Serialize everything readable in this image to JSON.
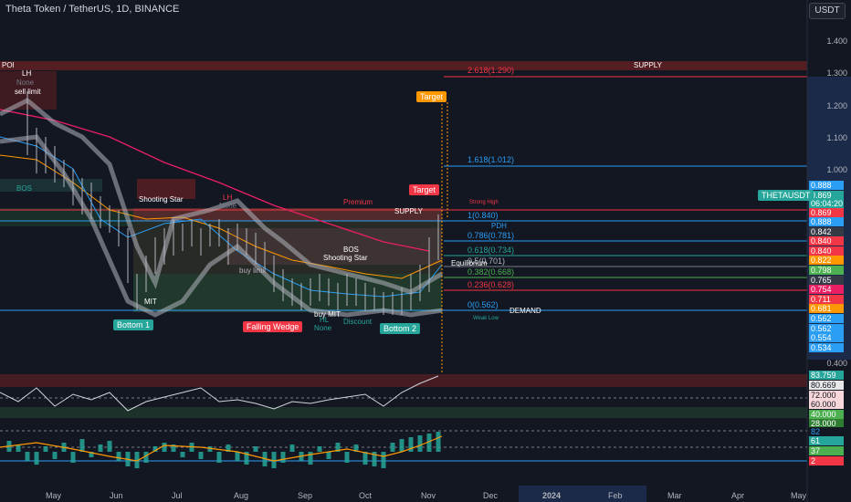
{
  "header": {
    "symbol_title": "Theta Token / TetherUS, 1D, BINANCE",
    "currency": "USDT"
  },
  "price_axis": [
    "1.400",
    "1.300",
    "1.200",
    "1.100",
    "1.000"
  ],
  "price_tags": [
    {
      "text": "0.888",
      "color": "#2a9df4"
    },
    {
      "text": "0.869",
      "color": "#26a69a"
    },
    {
      "text": "06:04:20",
      "color": "#26a69a"
    },
    {
      "text": "0.869",
      "color": "#f23645"
    },
    {
      "text": "0.888",
      "color": "#2a9df4"
    },
    {
      "text": "0.842",
      "color": "#363a45"
    },
    {
      "text": "0.840",
      "color": "#f23645"
    },
    {
      "text": "0.840",
      "color": "#f23645"
    },
    {
      "text": "0.822",
      "color": "#ff9800"
    },
    {
      "text": "0.798",
      "color": "#4caf50"
    },
    {
      "text": "0.765",
      "color": "#363a45"
    },
    {
      "text": "0.754",
      "color": "#e91e63"
    },
    {
      "text": "0.711",
      "color": "#f23645"
    },
    {
      "text": "0.681",
      "color": "#ff9800"
    },
    {
      "text": "0.562",
      "color": "#2a9df4"
    },
    {
      "text": "0.562",
      "color": "#2a9df4"
    },
    {
      "text": "0.554",
      "color": "#2a9df4"
    },
    {
      "text": "0.534",
      "color": "#2a9df4"
    }
  ],
  "lower_axis": {
    "low_price": "0.400",
    "osc1": [
      "83.759",
      "80.669",
      "72.000",
      "60.000",
      "40.000",
      "28.000"
    ],
    "osc2": [
      "82",
      "61",
      "37",
      "2"
    ]
  },
  "symbol_badge": "THETAUSDT",
  "time_axis": [
    "May",
    "Jun",
    "Jul",
    "Aug",
    "Sep",
    "Oct",
    "Nov",
    "Dec",
    "2024",
    "Feb",
    "Mar",
    "Apr",
    "May"
  ],
  "labels": {
    "poi": "POI",
    "supply_top": "SUPPLY",
    "fib_2618": "2.618(1.290)",
    "fib_1618": "1.618(1.012)",
    "fib_1": "1(0.840)",
    "fib_0786": "0.786(0.781)",
    "fib_0618": "0.618(0.734)",
    "fib_05": "0.5(0.701)",
    "fib_0382": "0.382(0.668)",
    "fib_0236": "0.236(0.628)",
    "fib_0": "0(0.562)",
    "target_top": "Target",
    "target_mid": "Target",
    "premium": "Premium",
    "supply_mid": "SUPPLY",
    "strong_high": "Strong High",
    "pdh": "PDH",
    "equilibrium": "Equilibrium",
    "demand": "DEMAND",
    "weak_low": "Weak Low",
    "bottom1": "Bottom 1",
    "bottom2": "Bottom 2",
    "falling_wedge": "Falling Wedge",
    "shooting_star1": "Shooting Star",
    "shooting_star2": "Shooting Star",
    "lh1": "LH",
    "none1": "None",
    "sell_limit": "sell limit",
    "lh2": "LH",
    "none2": "None",
    "bos1": "BOS",
    "bos2": "BOS",
    "buy_limit": "buy limit",
    "hl": "HL",
    "none3": "None",
    "discount": "Discount",
    "buy_mit": "buy MIT",
    "mit": "MIT"
  }
}
